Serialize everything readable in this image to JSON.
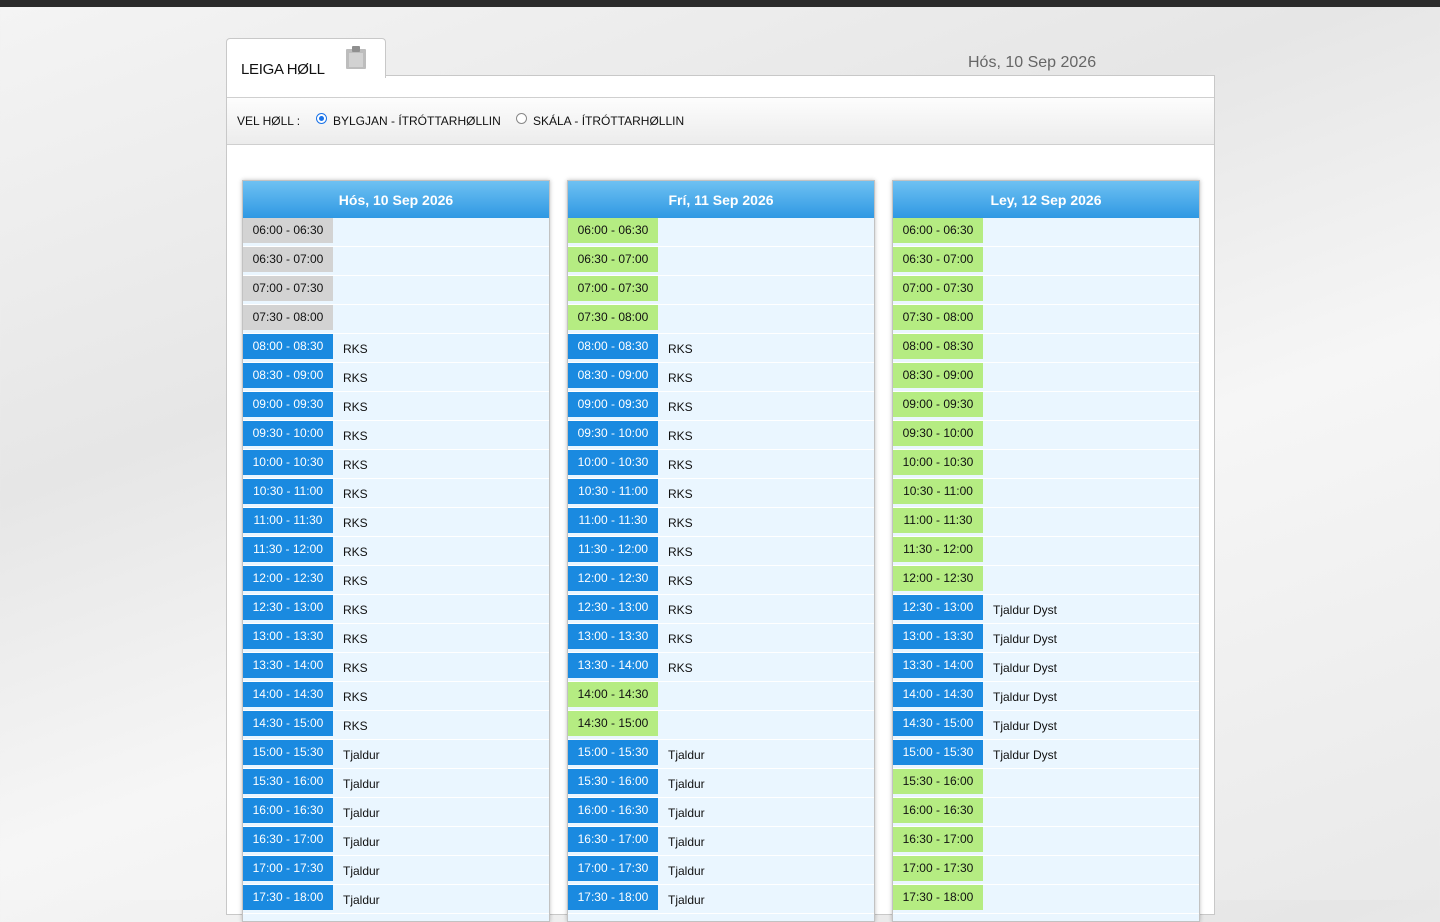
{
  "app": {
    "title": "LEIGA HØLL",
    "current_date": "Hós, 10 Sep 2026"
  },
  "colors": {
    "booked": "#1a8ae0",
    "free": "#b5ec82",
    "past": "#d3d3d3",
    "header": "#2f98e3"
  },
  "hall_select": {
    "label": "VEL HØLL :",
    "options": [
      {
        "label": "BYLGJAN - ÍTRÓTTARHØLLIN",
        "selected": true
      },
      {
        "label": "SKÁLA - ÍTRÓTTARHØLLIN",
        "selected": false
      }
    ]
  },
  "days": [
    {
      "header": "Hós, 10 Sep 2026",
      "slots": [
        {
          "time": "06:00 - 06:30",
          "status": "past",
          "booker": ""
        },
        {
          "time": "06:30 - 07:00",
          "status": "past",
          "booker": ""
        },
        {
          "time": "07:00 - 07:30",
          "status": "past",
          "booker": ""
        },
        {
          "time": "07:30 - 08:00",
          "status": "past",
          "booker": ""
        },
        {
          "time": "08:00 - 08:30",
          "status": "booked",
          "booker": "RKS"
        },
        {
          "time": "08:30 - 09:00",
          "status": "booked",
          "booker": "RKS"
        },
        {
          "time": "09:00 - 09:30",
          "status": "booked",
          "booker": "RKS"
        },
        {
          "time": "09:30 - 10:00",
          "status": "booked",
          "booker": "RKS"
        },
        {
          "time": "10:00 - 10:30",
          "status": "booked",
          "booker": "RKS"
        },
        {
          "time": "10:30 - 11:00",
          "status": "booked",
          "booker": "RKS"
        },
        {
          "time": "11:00 - 11:30",
          "status": "booked",
          "booker": "RKS"
        },
        {
          "time": "11:30 - 12:00",
          "status": "booked",
          "booker": "RKS"
        },
        {
          "time": "12:00 - 12:30",
          "status": "booked",
          "booker": "RKS"
        },
        {
          "time": "12:30 - 13:00",
          "status": "booked",
          "booker": "RKS"
        },
        {
          "time": "13:00 - 13:30",
          "status": "booked",
          "booker": "RKS"
        },
        {
          "time": "13:30 - 14:00",
          "status": "booked",
          "booker": "RKS"
        },
        {
          "time": "14:00 - 14:30",
          "status": "booked",
          "booker": "RKS"
        },
        {
          "time": "14:30 - 15:00",
          "status": "booked",
          "booker": "RKS"
        },
        {
          "time": "15:00 - 15:30",
          "status": "booked",
          "booker": "Tjaldur"
        },
        {
          "time": "15:30 - 16:00",
          "status": "booked",
          "booker": "Tjaldur"
        },
        {
          "time": "16:00 - 16:30",
          "status": "booked",
          "booker": "Tjaldur"
        },
        {
          "time": "16:30 - 17:00",
          "status": "booked",
          "booker": "Tjaldur"
        },
        {
          "time": "17:00 - 17:30",
          "status": "booked",
          "booker": "Tjaldur"
        },
        {
          "time": "17:30 - 18:00",
          "status": "booked",
          "booker": "Tjaldur"
        }
      ]
    },
    {
      "header": "Frí, 11 Sep 2026",
      "slots": [
        {
          "time": "06:00 - 06:30",
          "status": "free",
          "booker": ""
        },
        {
          "time": "06:30 - 07:00",
          "status": "free",
          "booker": ""
        },
        {
          "time": "07:00 - 07:30",
          "status": "free",
          "booker": ""
        },
        {
          "time": "07:30 - 08:00",
          "status": "free",
          "booker": ""
        },
        {
          "time": "08:00 - 08:30",
          "status": "booked",
          "booker": "RKS"
        },
        {
          "time": "08:30 - 09:00",
          "status": "booked",
          "booker": "RKS"
        },
        {
          "time": "09:00 - 09:30",
          "status": "booked",
          "booker": "RKS"
        },
        {
          "time": "09:30 - 10:00",
          "status": "booked",
          "booker": "RKS"
        },
        {
          "time": "10:00 - 10:30",
          "status": "booked",
          "booker": "RKS"
        },
        {
          "time": "10:30 - 11:00",
          "status": "booked",
          "booker": "RKS"
        },
        {
          "time": "11:00 - 11:30",
          "status": "booked",
          "booker": "RKS"
        },
        {
          "time": "11:30 - 12:00",
          "status": "booked",
          "booker": "RKS"
        },
        {
          "time": "12:00 - 12:30",
          "status": "booked",
          "booker": "RKS"
        },
        {
          "time": "12:30 - 13:00",
          "status": "booked",
          "booker": "RKS"
        },
        {
          "time": "13:00 - 13:30",
          "status": "booked",
          "booker": "RKS"
        },
        {
          "time": "13:30 - 14:00",
          "status": "booked",
          "booker": "RKS"
        },
        {
          "time": "14:00 - 14:30",
          "status": "free",
          "booker": ""
        },
        {
          "time": "14:30 - 15:00",
          "status": "free",
          "booker": ""
        },
        {
          "time": "15:00 - 15:30",
          "status": "booked",
          "booker": "Tjaldur"
        },
        {
          "time": "15:30 - 16:00",
          "status": "booked",
          "booker": "Tjaldur"
        },
        {
          "time": "16:00 - 16:30",
          "status": "booked",
          "booker": "Tjaldur"
        },
        {
          "time": "16:30 - 17:00",
          "status": "booked",
          "booker": "Tjaldur"
        },
        {
          "time": "17:00 - 17:30",
          "status": "booked",
          "booker": "Tjaldur"
        },
        {
          "time": "17:30 - 18:00",
          "status": "booked",
          "booker": "Tjaldur"
        }
      ]
    },
    {
      "header": "Ley, 12 Sep 2026",
      "slots": [
        {
          "time": "06:00 - 06:30",
          "status": "free",
          "booker": ""
        },
        {
          "time": "06:30 - 07:00",
          "status": "free",
          "booker": ""
        },
        {
          "time": "07:00 - 07:30",
          "status": "free",
          "booker": ""
        },
        {
          "time": "07:30 - 08:00",
          "status": "free",
          "booker": ""
        },
        {
          "time": "08:00 - 08:30",
          "status": "free",
          "booker": ""
        },
        {
          "time": "08:30 - 09:00",
          "status": "free",
          "booker": ""
        },
        {
          "time": "09:00 - 09:30",
          "status": "free",
          "booker": ""
        },
        {
          "time": "09:30 - 10:00",
          "status": "free",
          "booker": ""
        },
        {
          "time": "10:00 - 10:30",
          "status": "free",
          "booker": ""
        },
        {
          "time": "10:30 - 11:00",
          "status": "free",
          "booker": ""
        },
        {
          "time": "11:00 - 11:30",
          "status": "free",
          "booker": ""
        },
        {
          "time": "11:30 - 12:00",
          "status": "free",
          "booker": ""
        },
        {
          "time": "12:00 - 12:30",
          "status": "free",
          "booker": ""
        },
        {
          "time": "12:30 - 13:00",
          "status": "booked",
          "booker": "Tjaldur Dyst"
        },
        {
          "time": "13:00 - 13:30",
          "status": "booked",
          "booker": "Tjaldur Dyst"
        },
        {
          "time": "13:30 - 14:00",
          "status": "booked",
          "booker": "Tjaldur Dyst"
        },
        {
          "time": "14:00 - 14:30",
          "status": "booked",
          "booker": "Tjaldur Dyst"
        },
        {
          "time": "14:30 - 15:00",
          "status": "booked",
          "booker": "Tjaldur Dyst"
        },
        {
          "time": "15:00 - 15:30",
          "status": "booked",
          "booker": "Tjaldur Dyst"
        },
        {
          "time": "15:30 - 16:00",
          "status": "free",
          "booker": ""
        },
        {
          "time": "16:00 - 16:30",
          "status": "free",
          "booker": ""
        },
        {
          "time": "16:30 - 17:00",
          "status": "free",
          "booker": ""
        },
        {
          "time": "17:00 - 17:30",
          "status": "free",
          "booker": ""
        },
        {
          "time": "17:30 - 18:00",
          "status": "free",
          "booker": ""
        }
      ]
    }
  ]
}
